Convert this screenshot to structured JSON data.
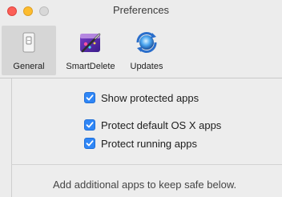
{
  "window": {
    "title": "Preferences"
  },
  "toolbar": {
    "items": [
      {
        "label": "General",
        "icon": "general-switch-icon",
        "selected": true
      },
      {
        "label": "SmartDelete",
        "icon": "smartdelete-icon",
        "selected": false
      },
      {
        "label": "Updates",
        "icon": "updates-icon",
        "selected": false
      }
    ]
  },
  "general": {
    "options": [
      {
        "label": "Show protected apps",
        "checked": true
      },
      {
        "label": "Protect default OS X apps",
        "checked": true
      },
      {
        "label": "Protect running apps",
        "checked": true
      }
    ],
    "info_text": "Add additional apps to keep safe below."
  },
  "colors": {
    "checkbox_accent": "#2f86f6",
    "close": "#fc5f57",
    "minimize": "#fdbc2e",
    "zoom_disabled": "#d8d8d8"
  }
}
